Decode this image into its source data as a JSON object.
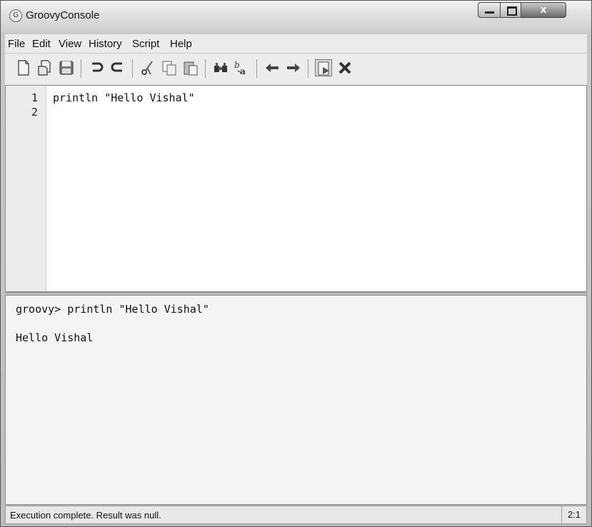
{
  "window": {
    "title": "GroovyConsole",
    "close_glyph": "x"
  },
  "menu": [
    "File",
    "Edit",
    "View",
    "History",
    "Script",
    "Help"
  ],
  "toolbar": {
    "icons": [
      "new-file-icon",
      "open-file-icon",
      "save-icon",
      "undo-icon",
      "redo-icon",
      "cut-icon",
      "copy-icon",
      "paste-icon",
      "find-icon",
      "replace-icon",
      "previous-history-icon",
      "next-history-icon",
      "run-script-icon",
      "interrupt-icon"
    ]
  },
  "editor": {
    "line_numbers": [
      "1",
      "2"
    ],
    "lines": [
      "println \"Hello Vishal\"",
      ""
    ]
  },
  "output": {
    "lines": [
      "groovy> println \"Hello Vishal\"",
      "",
      "Hello Vishal"
    ]
  },
  "status": {
    "message": "Execution complete. Result was null.",
    "position": "2:1"
  }
}
